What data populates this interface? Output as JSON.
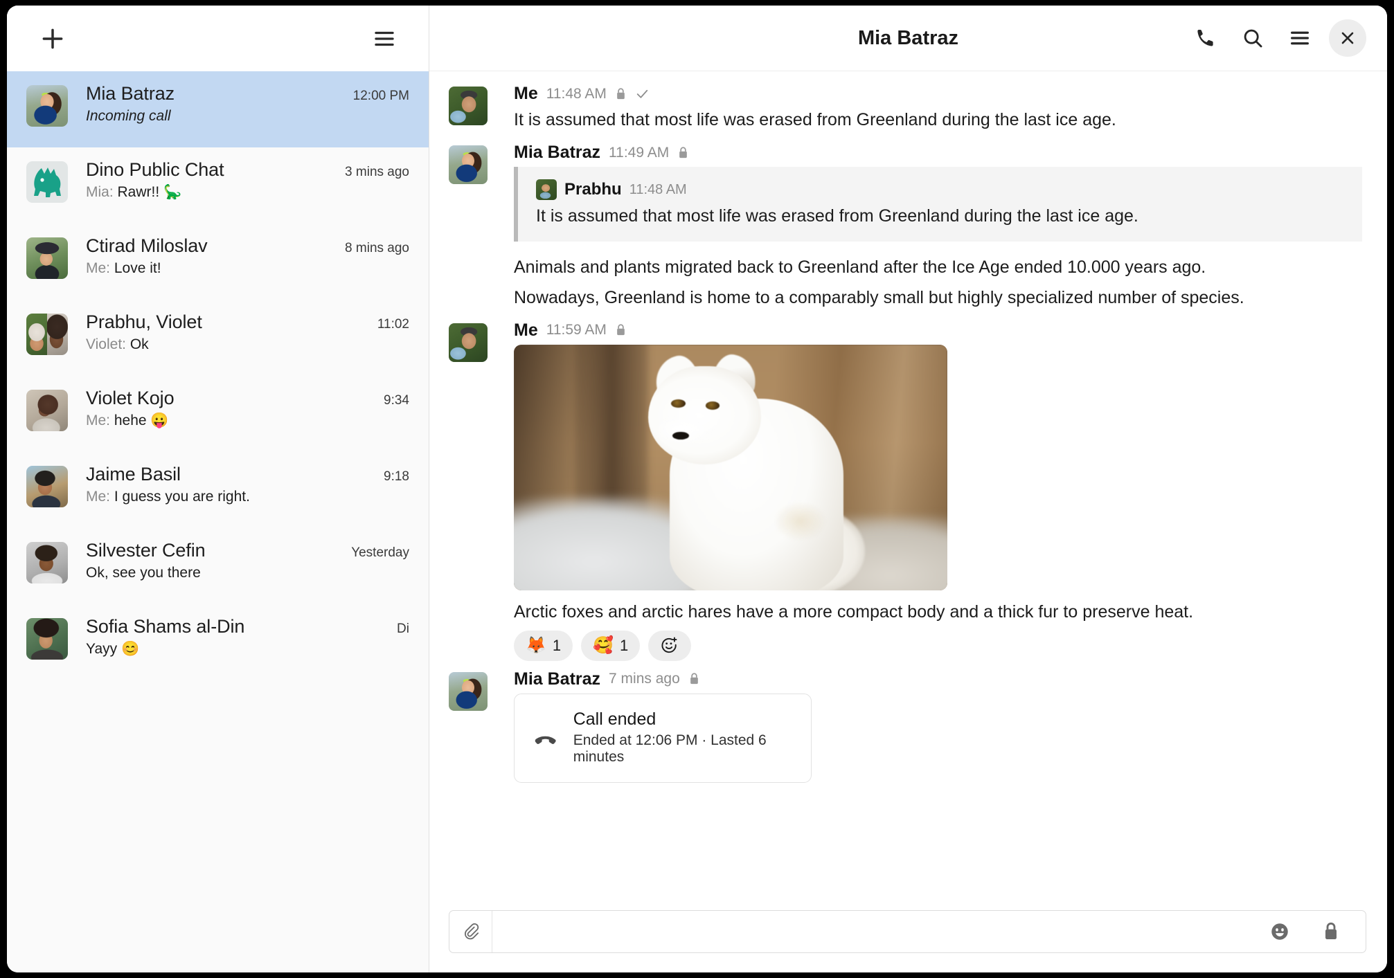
{
  "sidebar": {
    "new_chat_label": "+",
    "menu_label": "menu",
    "items": [
      {
        "name": "Mia Batraz",
        "time": "12:00 PM",
        "prefix": "",
        "preview": "Incoming call",
        "italic": true,
        "selected": true,
        "avatar": "mia"
      },
      {
        "name": "Dino Public Chat",
        "time": "3 mins ago",
        "prefix": "Mia: ",
        "preview": "Rawr!! 🦕",
        "italic": false,
        "selected": false,
        "avatar": "dino"
      },
      {
        "name": "Ctirad Miloslav",
        "time": "8 mins ago",
        "prefix": "Me: ",
        "preview": "Love it!",
        "italic": false,
        "selected": false,
        "avatar": "ctirad"
      },
      {
        "name": "Prabhu, Violet",
        "time": "11:02",
        "prefix": "Violet: ",
        "preview": "Ok",
        "italic": false,
        "selected": false,
        "avatar": "split"
      },
      {
        "name": "Violet Kojo",
        "time": "9:34",
        "prefix": "Me: ",
        "preview": "hehe 😛",
        "italic": false,
        "selected": false,
        "avatar": "violet"
      },
      {
        "name": "Jaime Basil",
        "time": "9:18",
        "prefix": "Me: ",
        "preview": "I guess you are right.",
        "italic": false,
        "selected": false,
        "avatar": "jaime"
      },
      {
        "name": "Silvester Cefin",
        "time": "Yesterday",
        "prefix": "",
        "preview": "Ok, see you there",
        "italic": false,
        "selected": false,
        "avatar": "silvester"
      },
      {
        "name": "Sofia Shams al-Din",
        "time": "Di",
        "prefix": "",
        "preview": "Yayy 😊",
        "italic": false,
        "selected": false,
        "avatar": "sofia"
      }
    ]
  },
  "header": {
    "title": "Mia Batraz",
    "call_icon": "phone-icon",
    "search_icon": "search-icon",
    "menu_icon": "hamburger-icon",
    "close_icon": "close-icon"
  },
  "messages": [
    {
      "sender": "Me",
      "time": "11:48 AM",
      "encrypted": true,
      "receipt": "✓",
      "avatar": "me",
      "text": "It is assumed that most life was erased from Greenland during the last ice age."
    },
    {
      "sender": "Mia Batraz",
      "time": "11:49 AM",
      "encrypted": true,
      "avatar": "mia",
      "quote": {
        "sender": "Prabhu",
        "time": "11:48 AM",
        "text": "It is assumed that most life was erased from Greenland during the last ice age."
      },
      "paragraphs": [
        "Animals and plants migrated back to Greenland after the Ice Age ended 10.000 years ago.",
        "Nowadays, Greenland is home to a comparably small but highly specialized number of species."
      ]
    },
    {
      "sender": "Me",
      "time": "11:59 AM",
      "encrypted": true,
      "avatar": "me",
      "image_alt": "arctic-fox-photo",
      "caption": "Arctic foxes and arctic hares have a more compact body and a thick fur to preserve heat.",
      "reactions": [
        {
          "emoji": "🦊",
          "count": "1"
        },
        {
          "emoji": "🥰",
          "count": "1"
        }
      ],
      "add_reaction_icon": "add-reaction-icon"
    },
    {
      "sender": "Mia Batraz",
      "time": "7 mins ago",
      "encrypted": true,
      "avatar": "mia",
      "call": {
        "icon": "call-ended-icon",
        "title": "Call ended",
        "subtitle": "Ended at 12:06 PM · Lasted 6 minutes"
      }
    }
  ],
  "composer": {
    "attach_icon": "paperclip-icon",
    "placeholder": "",
    "value": "",
    "emoji_icon": "emoji-icon",
    "encryption_icon": "lock-icon"
  },
  "colors": {
    "selected_chat": "#c2d8f2",
    "sidebar_bg": "#fafafa",
    "quote_bg": "#f4f4f4",
    "reaction_bg": "#ededed"
  }
}
